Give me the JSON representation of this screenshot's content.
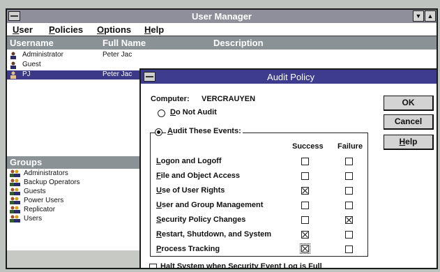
{
  "window": {
    "title": "User Manager",
    "menu": [
      "User",
      "Policies",
      "Options",
      "Help"
    ],
    "columns": [
      "Username",
      "Full Name",
      "Description"
    ],
    "users": [
      {
        "username": "Administrator",
        "full_name": "Peter Jac"
      },
      {
        "username": "Guest",
        "full_name": ""
      },
      {
        "username": "PJ",
        "full_name": "Peter Jac",
        "selected": true
      }
    ],
    "groups_header": "Groups",
    "groups": [
      "Administrators",
      "Backup Operators",
      "Guests",
      "Power Users",
      "Replicator",
      "Users"
    ]
  },
  "dialog": {
    "title": "Audit Policy",
    "computer_label": "Computer:",
    "computer_name": "VERCRAUYEN",
    "radio_no_audit": "Do Not Audit",
    "radio_audit_events": "Audit These Events:",
    "selected_mode": "audit_events",
    "col_success": "Success",
    "col_failure": "Failure",
    "events": [
      {
        "label": "Logon and Logoff",
        "success": false,
        "failure": false
      },
      {
        "label": "File and Object Access",
        "success": false,
        "failure": false
      },
      {
        "label": "Use of User Rights",
        "success": true,
        "failure": false
      },
      {
        "label": "User and Group Management",
        "success": false,
        "failure": false
      },
      {
        "label": "Security Policy Changes",
        "success": false,
        "failure": true
      },
      {
        "label": "Restart, Shutdown, and System",
        "success": true,
        "failure": false
      },
      {
        "label": "Process Tracking",
        "success": true,
        "failure": false
      }
    ],
    "halt_label": "Halt System when Security Event Log is Full",
    "halt_checked": false,
    "buttons": {
      "ok": "OK",
      "cancel": "Cancel",
      "help": "Help"
    }
  },
  "colors": {
    "dialog_title": "#3e3c8f",
    "window_title": "#8e8f9b",
    "selection": "#3c3a88"
  }
}
